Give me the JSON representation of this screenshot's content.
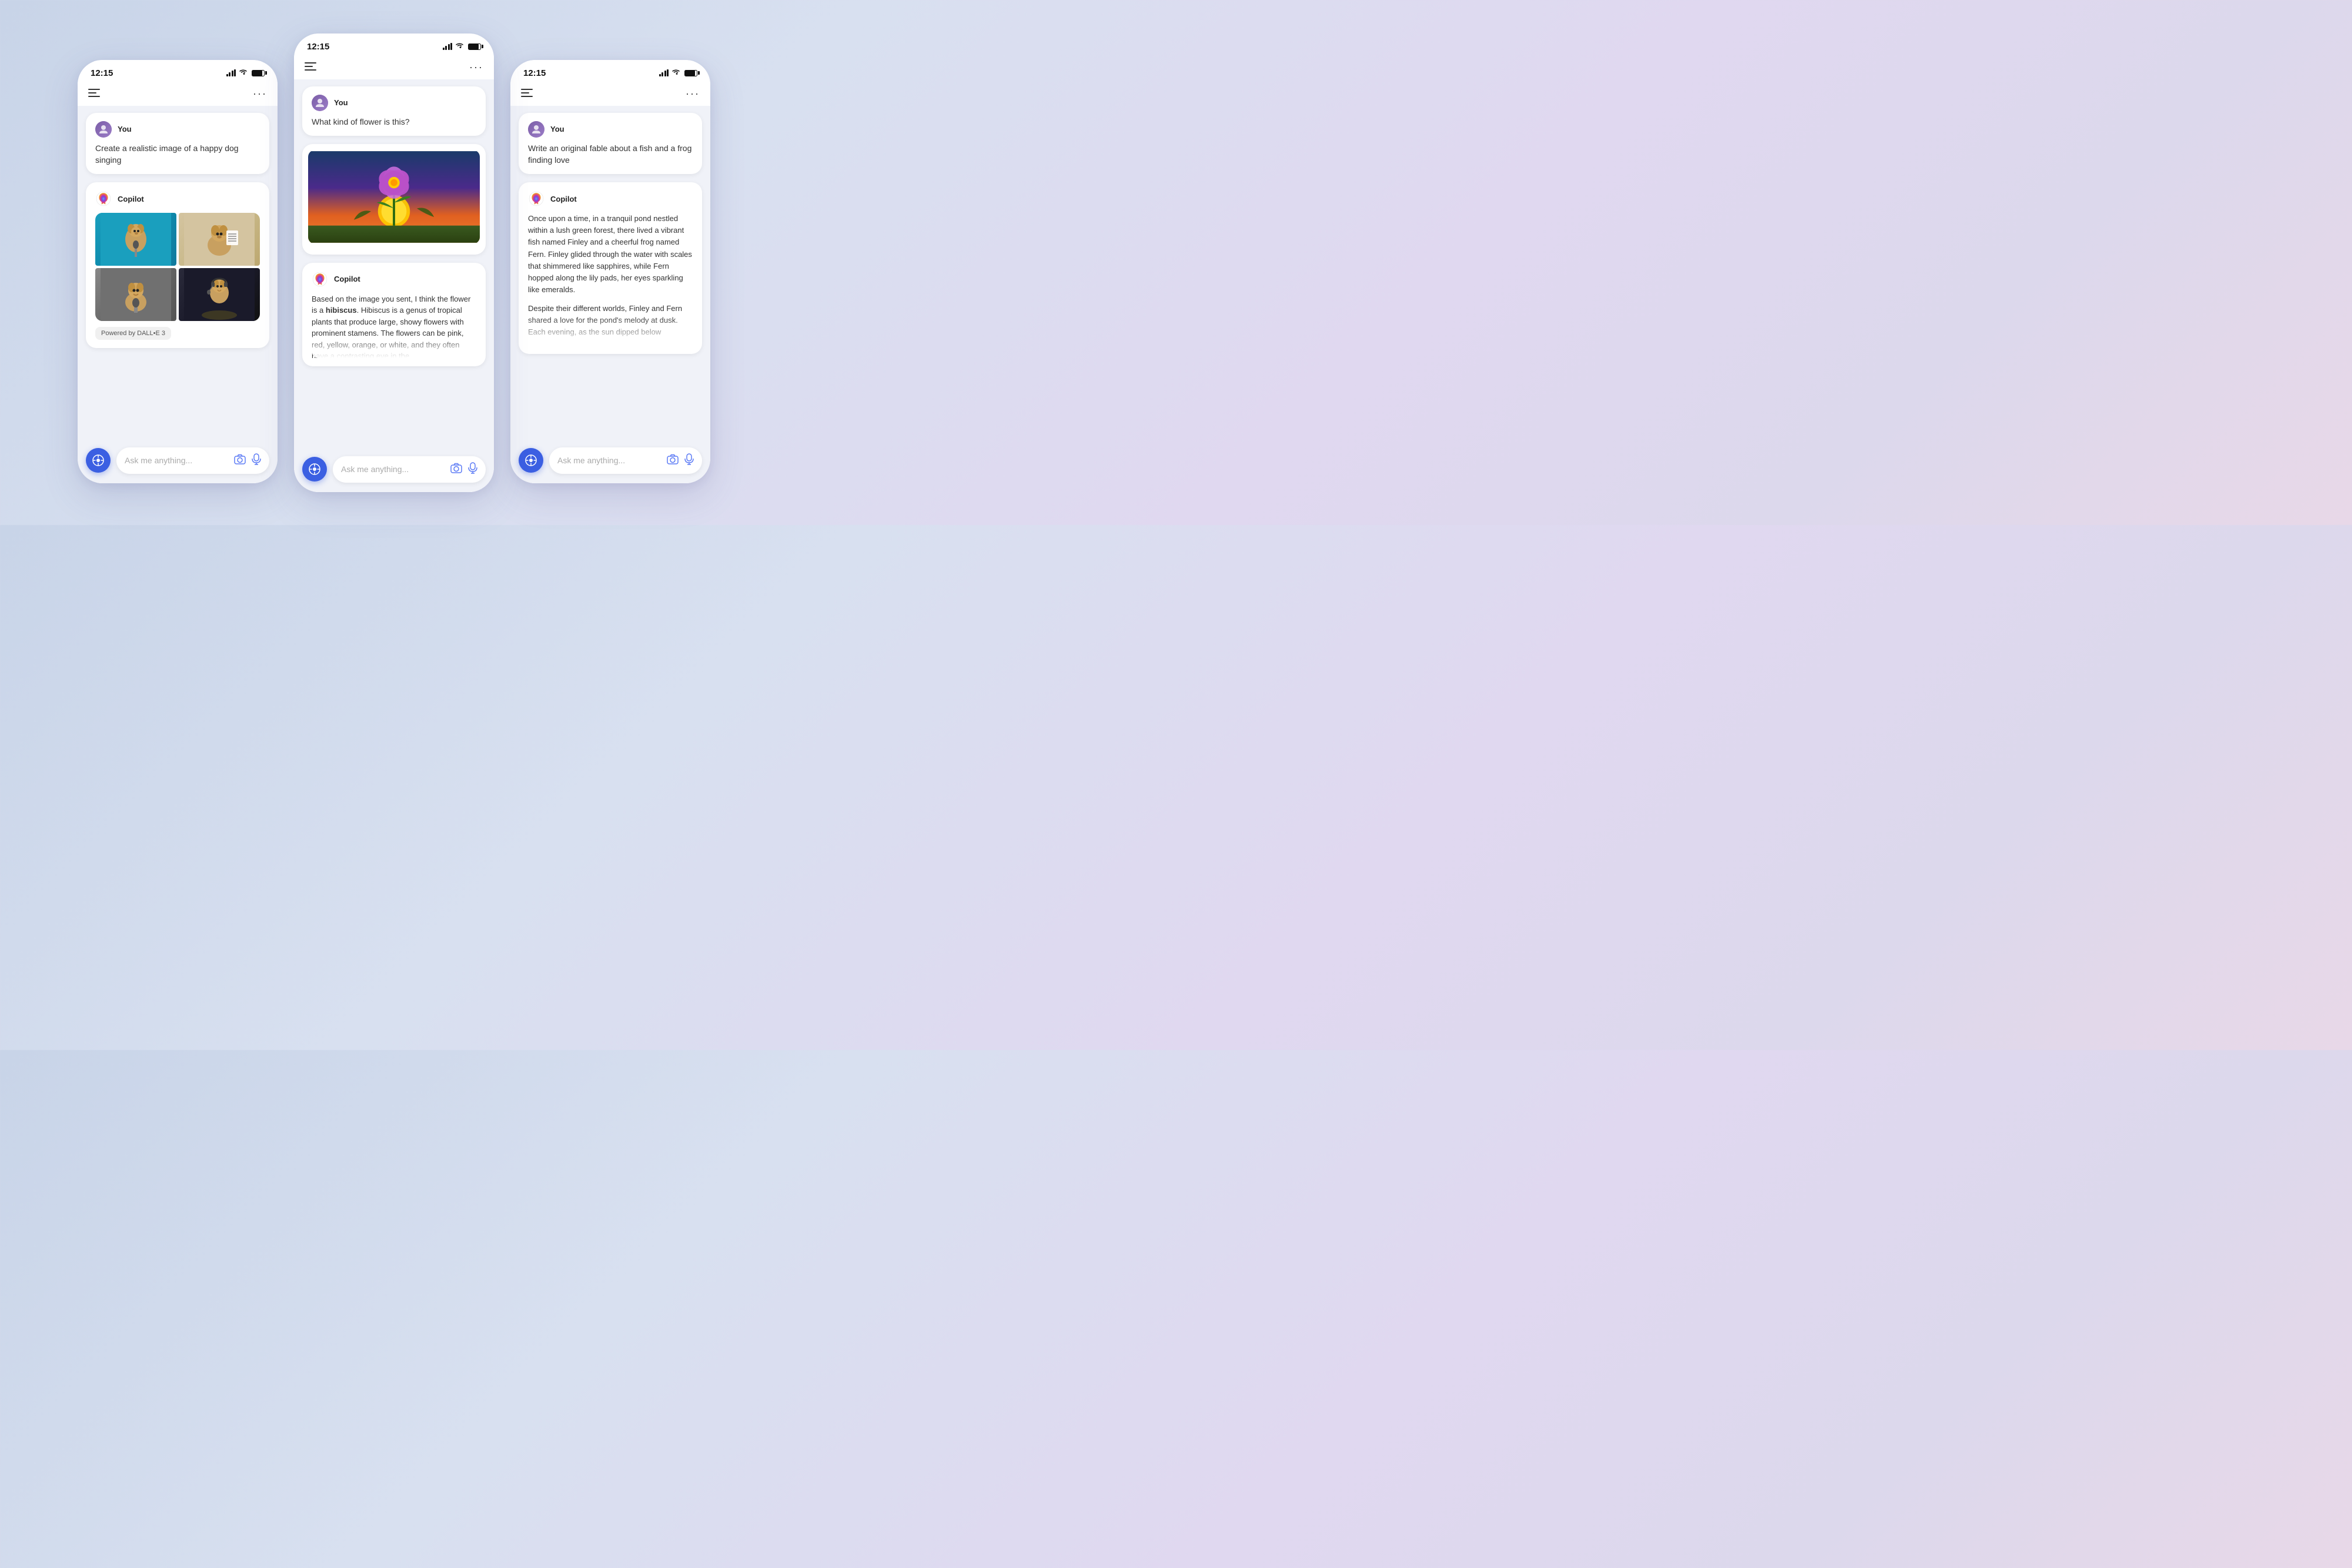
{
  "background": {
    "gradient_start": "#c8d4e8",
    "gradient_end": "#e8d8e8"
  },
  "phones": [
    {
      "id": "left",
      "status_bar": {
        "time": "12:15",
        "signal": 4,
        "wifi": true,
        "battery": 85
      },
      "nav": {
        "menu_icon": "≡",
        "more_icon": "..."
      },
      "user_message": {
        "avatar_text": "👤",
        "name": "You",
        "text": "Create a realistic image of a happy dog singing"
      },
      "copilot_response": {
        "name": "Copilot",
        "type": "image_grid",
        "dalle_badge": "Powered by DALL•E 3"
      },
      "input": {
        "placeholder": "Ask me anything...",
        "camera_icon": "📷",
        "mic_icon": "🎤"
      }
    },
    {
      "id": "center",
      "status_bar": {
        "time": "12:15",
        "signal": 4,
        "wifi": true,
        "battery": 85
      },
      "nav": {
        "menu_icon": "≡",
        "more_icon": "..."
      },
      "user_message": {
        "avatar_text": "👤",
        "name": "You",
        "text": "What kind of flower is this?"
      },
      "copilot_response": {
        "name": "Copilot",
        "type": "text_with_image",
        "text_before_bold": "Based on the image you sent, I think the flower is a ",
        "bold_word": "hibiscus",
        "text_after": ". Hibiscus is a genus of tropical plants that produce large, showy flowers with prominent stamens. The flowers can be pink, red, yellow, orange, or white, and they often have a contrasting eye in the"
      },
      "input": {
        "placeholder": "Ask me anything...",
        "camera_icon": "📷",
        "mic_icon": "🎤"
      }
    },
    {
      "id": "right",
      "status_bar": {
        "time": "12:15",
        "signal": 4,
        "wifi": true,
        "battery": 85
      },
      "nav": {
        "menu_icon": "≡",
        "more_icon": "..."
      },
      "user_message": {
        "avatar_text": "👤",
        "name": "You",
        "text": "Write an original fable about a fish and a frog finding love"
      },
      "copilot_response": {
        "name": "Copilot",
        "type": "fable",
        "paragraph1": "Once upon a time, in a tranquil pond nestled within a lush green forest, there lived a vibrant fish named Finley and a cheerful frog named Fern. Finley glided through the water with scales that shimmered like sapphires, while Fern hopped along the lily pads, her eyes sparkling like emeralds.",
        "paragraph2": "Despite their different worlds, Finley and Fern shared a love for the pond's melody at dusk. Each evening, as the sun dipped below"
      },
      "input": {
        "placeholder": "Ask me anything...",
        "camera_icon": "📷",
        "mic_icon": "🎤"
      }
    }
  ]
}
